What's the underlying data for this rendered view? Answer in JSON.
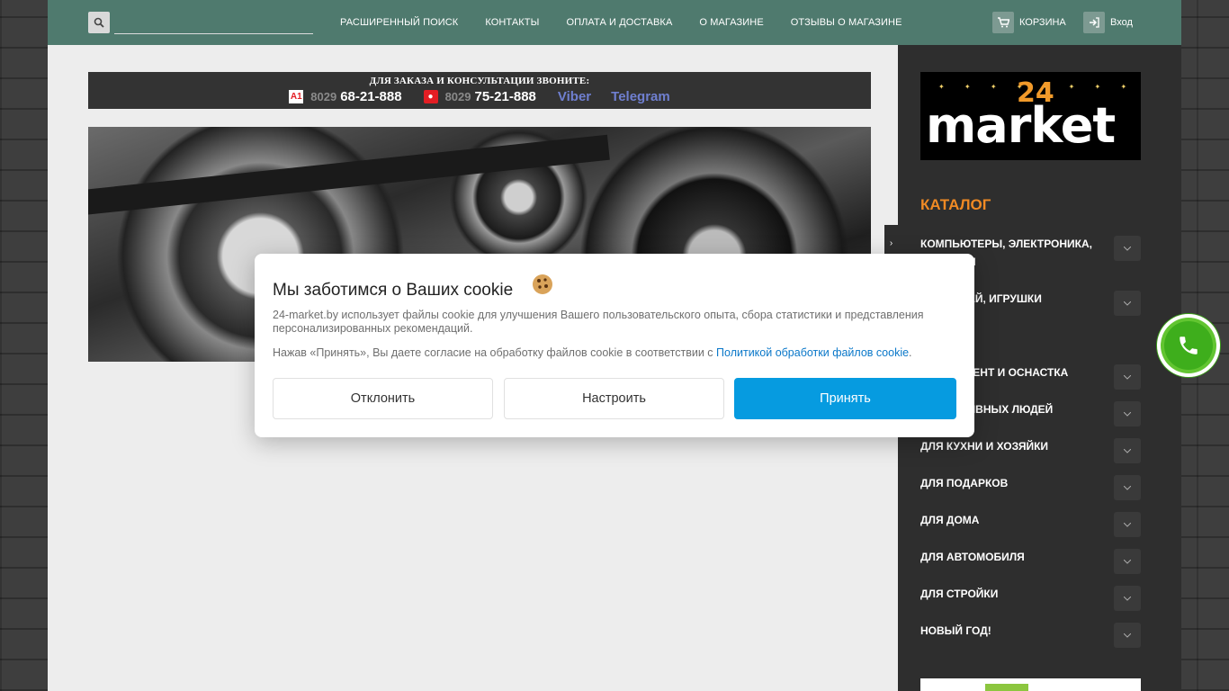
{
  "header": {
    "search_placeholder": "",
    "nav": [
      "РАСШИРЕННЫЙ ПОИСК",
      "КОНТАКТЫ",
      "ОПЛАТА И ДОСТАВКА",
      "О МАГАЗИНЕ",
      "ОТЗЫВЫ О МАГАЗИНЕ"
    ],
    "cart_label": "КОРЗИНА",
    "login_label": "Вход"
  },
  "phone_banner": {
    "title": "ДЛЯ ЗАКАЗА И КОНСУЛЬТАЦИИ ЗВОНИТЕ:",
    "a1_logo": "A1",
    "a1_code": "8029",
    "a1_number": "68-21-888",
    "mts_code": "8029",
    "mts_number": "75-21-888",
    "viber": "Viber",
    "telegram": "Telegram"
  },
  "sidebar": {
    "logo_num": "24",
    "logo_word": "market",
    "catalog_title": "КАТАЛОГ",
    "categories": [
      "КОМПЬЮТЕРЫ, ЭЛЕКТРОНИКА, ГАДЖЕТЫ",
      "ДЛЯ ДЕТЕЙ, ИГРУШКИ",
      "",
      "ИНСТРУМЕНТ И ОСНАСТКА",
      "ДЛЯ АКТИВНЫХ ЛЮДЕЙ (СПОРТ)",
      "ДЛЯ КУХНИ И ХОЗЯЙКИ",
      "ДЛЯ ПОДАРКОВ",
      "ДЛЯ ДОМА",
      "ДЛЯ АВТОМОБИЛЯ",
      "ДЛЯ СТРОЙКИ",
      "НОВЫЙ ГОД!"
    ]
  },
  "cookie": {
    "title": "Мы заботимся о Ваших cookie",
    "text": "24-market.by использует файлы cookie для улучшения Вашего пользовательского опыта, сбора статистики и представления персонализированных рекомендаций.",
    "consent_prefix": "Нажав «Принять», Вы даете согласие на обработку файлов cookie в соответствии с ",
    "consent_link": "Политикой обработки файлов cookie",
    "consent_suffix": ".",
    "decline": "Отклонить",
    "configure": "Настроить",
    "accept": "Принять"
  },
  "colors": {
    "topbar": "#4f7a6e",
    "catalog_accent": "#f08a24",
    "accept_button": "#069be0",
    "call_button": "#62c531"
  }
}
